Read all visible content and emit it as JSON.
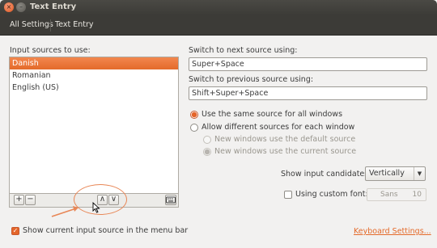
{
  "window": {
    "title": "Text Entry",
    "close_glyph": "×",
    "minimize_glyph": "–"
  },
  "nav": {
    "all_settings": "All Settings",
    "current": "Text Entry"
  },
  "left": {
    "list_label": "Input sources to use:",
    "sources": [
      "Danish",
      "Romanian",
      "English (US)"
    ],
    "selected_index": 0,
    "toolbar": {
      "add": "+",
      "remove": "−",
      "up": "∧",
      "down": "∨"
    },
    "show_menu_checkbox": {
      "label": "Show current input source in the menu bar",
      "checked": true
    }
  },
  "right": {
    "next_label": "Switch to next source using:",
    "next_value": "Super+Space",
    "prev_label": "Switch to previous source using:",
    "prev_value": "Shift+Super+Space",
    "radio_same": "Use the same source for all windows",
    "radio_diff": "Allow different sources for each window",
    "sub_default": "New windows use the default source",
    "sub_current": "New windows use the current source",
    "candidates_label": "Show input candidates:",
    "candidates_value": "Vertically",
    "custom_font_label": "Using custom font:",
    "font_name": "Sans",
    "font_size": "10",
    "keyboard_link": "Keyboard Settings..."
  },
  "colors": {
    "accent": "#e46a2a",
    "annotation": "#e88655"
  }
}
